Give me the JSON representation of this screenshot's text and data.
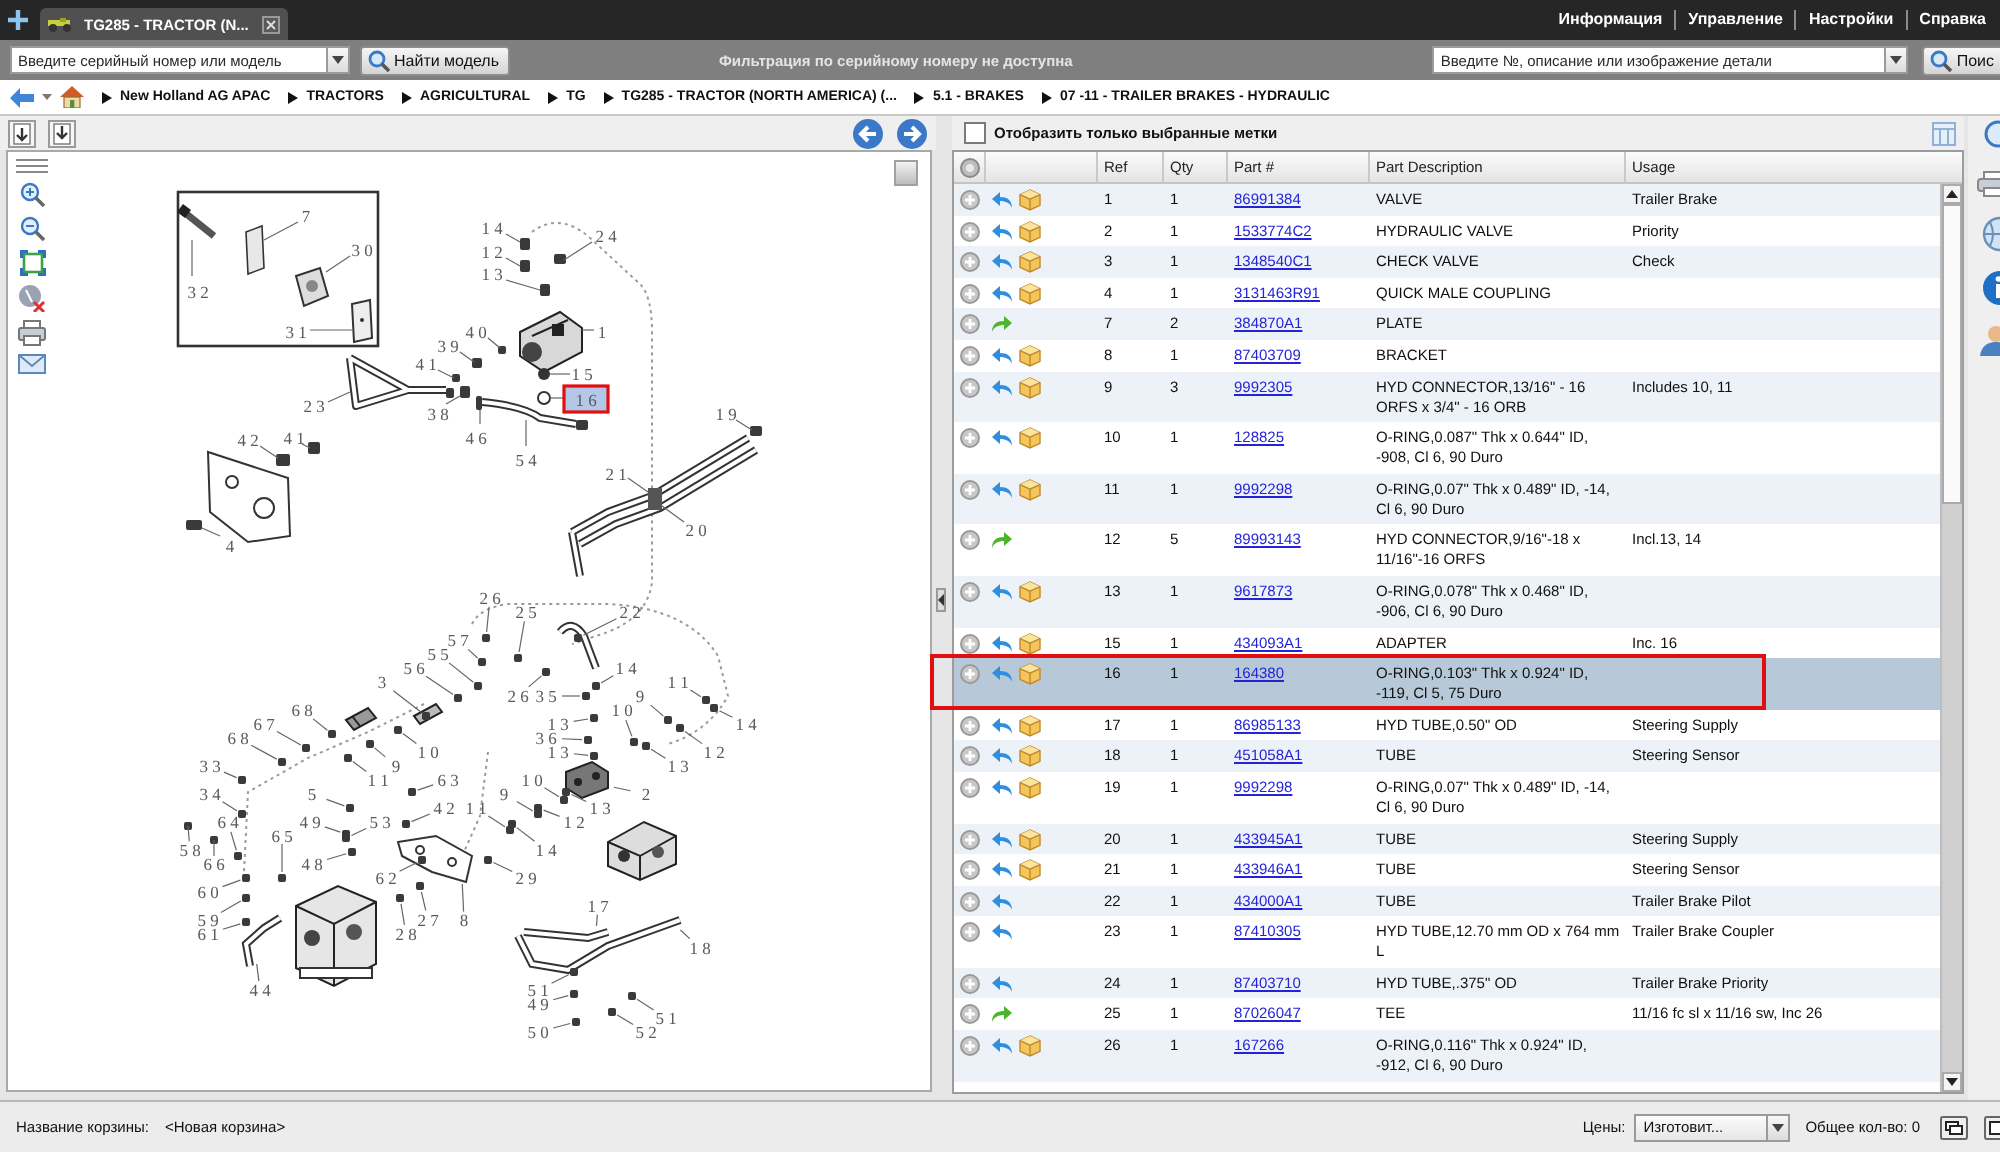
{
  "top_bar": {
    "tabs": [
      {
        "label": "TG285 - TRACTOR (N...",
        "selected": true
      }
    ],
    "links": [
      "Информация",
      "Управление",
      "Настройки",
      "Справка"
    ]
  },
  "search_bar": {
    "model_field": {
      "placeholder": "Введите серийный номер или модель"
    },
    "model_button": "Найти модель",
    "filter_notice": "Фильтрация по серийному номеру не доступна",
    "part_field": {
      "placeholder": "Введите №, описание или изображение детали"
    },
    "part_button": "Поис"
  },
  "breadcrumb": [
    "New Holland AG APAC",
    "TRACTORS",
    "AGRICULTURAL",
    "TG",
    "TG285 - TRACTOR (NORTH AMERICA) (...",
    "5.1 - BRAKES",
    "07 -11 - TRAILER BRAKES - HYDRAULIC"
  ],
  "diagram": {
    "callouts": [
      {
        "label": "7",
        "selected": false
      },
      {
        "label": "1 4",
        "selected": false
      },
      {
        "label": "2 4",
        "selected": false
      },
      {
        "label": "3 0",
        "selected": false
      },
      {
        "label": "1 2",
        "selected": false
      },
      {
        "label": "1 3",
        "selected": false
      },
      {
        "label": "3 2",
        "selected": false
      },
      {
        "label": "3 1",
        "selected": false
      },
      {
        "label": "4 0",
        "selected": false
      },
      {
        "label": "1",
        "selected": false
      },
      {
        "label": "3 9",
        "selected": false
      },
      {
        "label": "4 1",
        "selected": false
      },
      {
        "label": "1 5",
        "selected": false
      },
      {
        "label": "2 3",
        "selected": false
      },
      {
        "label": "3 8",
        "selected": false
      },
      {
        "label": "1 6",
        "selected": true
      },
      {
        "label": "1 9",
        "selected": false
      },
      {
        "label": "4 2",
        "selected": false
      },
      {
        "label": "4 1",
        "selected": false
      },
      {
        "label": "4 6",
        "selected": false
      },
      {
        "label": "5 4",
        "selected": false
      },
      {
        "label": "2 1",
        "selected": false
      },
      {
        "label": "2 0",
        "selected": false
      },
      {
        "label": "4",
        "selected": false
      },
      {
        "label": "2 6",
        "selected": false
      },
      {
        "label": "2 5",
        "selected": false
      },
      {
        "label": "2 2",
        "selected": false
      },
      {
        "label": "5 7",
        "selected": false
      },
      {
        "label": "5 5",
        "selected": false
      },
      {
        "label": "5 6",
        "selected": false
      },
      {
        "label": "1 4",
        "selected": false
      },
      {
        "label": "3",
        "selected": false
      },
      {
        "label": "1 1",
        "selected": false
      },
      {
        "label": "2 6",
        "selected": false
      },
      {
        "label": "3 5",
        "selected": false
      },
      {
        "label": "9",
        "selected": false
      },
      {
        "label": "6 8",
        "selected": false
      },
      {
        "label": "1 0",
        "selected": false
      },
      {
        "label": "6 7",
        "selected": false
      },
      {
        "label": "1 3",
        "selected": false
      },
      {
        "label": "1 4",
        "selected": false
      },
      {
        "label": "6 8",
        "selected": false
      },
      {
        "label": "3 6",
        "selected": false
      },
      {
        "label": "1 0",
        "selected": false
      },
      {
        "label": "1 3",
        "selected": false
      },
      {
        "label": "1 2",
        "selected": false
      },
      {
        "label": "3 3",
        "selected": false
      },
      {
        "label": "9",
        "selected": false
      },
      {
        "label": "1 3",
        "selected": false
      },
      {
        "label": "1 1",
        "selected": false
      },
      {
        "label": "6 3",
        "selected": false
      },
      {
        "label": "1 0",
        "selected": false
      },
      {
        "label": "3 4",
        "selected": false
      },
      {
        "label": "5",
        "selected": false
      },
      {
        "label": "9",
        "selected": false
      },
      {
        "label": "2",
        "selected": false
      },
      {
        "label": "4 2",
        "selected": false
      },
      {
        "label": "1 1",
        "selected": false
      },
      {
        "label": "1 3",
        "selected": false
      },
      {
        "label": "6 4",
        "selected": false
      },
      {
        "label": "4 9",
        "selected": false
      },
      {
        "label": "5 3",
        "selected": false
      },
      {
        "label": "1 2",
        "selected": false
      },
      {
        "label": "6 5",
        "selected": false
      },
      {
        "label": "5 8",
        "selected": false
      },
      {
        "label": "1 4",
        "selected": false
      },
      {
        "label": "6 6",
        "selected": false
      },
      {
        "label": "4 8",
        "selected": false
      },
      {
        "label": "6 2",
        "selected": false
      },
      {
        "label": "2 9",
        "selected": false
      },
      {
        "label": "6 0",
        "selected": false
      },
      {
        "label": "1 7",
        "selected": false
      },
      {
        "label": "5 9",
        "selected": false
      },
      {
        "label": "2 7",
        "selected": false
      },
      {
        "label": "8",
        "selected": false
      },
      {
        "label": "6 1",
        "selected": false
      },
      {
        "label": "2 8",
        "selected": false
      },
      {
        "label": "1 8",
        "selected": false
      },
      {
        "label": "4 4",
        "selected": false
      },
      {
        "label": "5 1",
        "selected": false
      },
      {
        "label": "4 9",
        "selected": false
      },
      {
        "label": "5 1",
        "selected": false
      },
      {
        "label": "5 0",
        "selected": false
      },
      {
        "label": "5 2",
        "selected": false
      }
    ]
  },
  "parts_panel": {
    "filter": {
      "label": "Отобразить только выбранные метки",
      "checked": false
    },
    "columns": [
      "Ref",
      "Qty",
      "Part #",
      "Part Description",
      "Usage"
    ],
    "rows": [
      {
        "kind": "part",
        "ref": "1",
        "qty": "1",
        "part": "86991384",
        "description": "VALVE",
        "usage": "Trailer Brake",
        "selected": false
      },
      {
        "kind": "part",
        "ref": "2",
        "qty": "1",
        "part": "1533774C2",
        "description": "HYDRAULIC VALVE",
        "usage": "Priority",
        "selected": false
      },
      {
        "kind": "part",
        "ref": "3",
        "qty": "1",
        "part": "1348540C1",
        "description": "CHECK VALVE",
        "usage": "Check",
        "selected": false
      },
      {
        "kind": "part",
        "ref": "4",
        "qty": "1",
        "part": "3131463R91",
        "description": "QUICK MALE COUPLING",
        "selected": false
      },
      {
        "kind": "kit",
        "ref": "7",
        "qty": "2",
        "part": "384870A1",
        "description": "PLATE",
        "selected": false
      },
      {
        "kind": "part",
        "ref": "8",
        "qty": "1",
        "part": "87403709",
        "description": "BRACKET",
        "selected": false
      },
      {
        "kind": "part",
        "ref": "9",
        "qty": "3",
        "part": "9992305",
        "description": "HYD CONNECTOR,13/16\" - 16 ORFS x 3/4\" - 16 ORB",
        "usage": "Includes 10, 11",
        "selected": false
      },
      {
        "kind": "part",
        "ref": "10",
        "qty": "1",
        "part": "128825",
        "description": "O-RING,0.087\" Thk x 0.644\" ID, -908, Cl 6, 90 Duro",
        "selected": false
      },
      {
        "kind": "part",
        "ref": "11",
        "qty": "1",
        "part": "9992298",
        "description": "O-RING,0.07\" Thk x 0.489\" ID, -14, Cl 6, 90 Duro",
        "selected": false
      },
      {
        "kind": "kit",
        "ref": "12",
        "qty": "5",
        "part": "89993143",
        "description": "HYD CONNECTOR,9/16\"-18 x 11/16\"-16 ORFS",
        "usage": "Incl.13, 14",
        "selected": false
      },
      {
        "kind": "part",
        "ref": "13",
        "qty": "1",
        "part": "9617873",
        "description": "O-RING,0.078\" Thk x 0.468\" ID, -906, Cl 6, 90 Duro",
        "selected": false
      },
      {
        "kind": "part",
        "ref": "15",
        "qty": "1",
        "part": "434093A1",
        "description": "ADAPTER",
        "usage": "Inc. 16",
        "selected": false
      },
      {
        "kind": "part",
        "ref": "16",
        "qty": "1",
        "part": "164380",
        "description": "O-RING,0.103\" Thk x 0.924\" ID, -119, Cl 5, 75 Duro",
        "selected": true
      },
      {
        "kind": "part",
        "ref": "17",
        "qty": "1",
        "part": "86985133",
        "description": "HYD TUBE,0.50\" OD",
        "usage": "Steering Supply",
        "selected": false
      },
      {
        "kind": "part",
        "ref": "18",
        "qty": "1",
        "part": "451058A1",
        "description": "TUBE",
        "usage": "Steering Sensor",
        "selected": false
      },
      {
        "kind": "part",
        "ref": "19",
        "qty": "1",
        "part": "9992298",
        "description": "O-RING,0.07\" Thk x 0.489\" ID, -14, Cl 6, 90 Duro",
        "selected": false
      },
      {
        "kind": "part",
        "ref": "20",
        "qty": "1",
        "part": "433945A1",
        "description": "TUBE",
        "usage": "Steering Supply",
        "selected": false
      },
      {
        "kind": "part",
        "ref": "21",
        "qty": "1",
        "part": "433946A1",
        "description": "TUBE",
        "usage": "Steering Sensor",
        "selected": false
      },
      {
        "kind": "link",
        "ref": "22",
        "qty": "1",
        "part": "434000A1",
        "description": "TUBE",
        "usage": "Trailer Brake Pilot",
        "selected": false
      },
      {
        "kind": "link",
        "ref": "23",
        "qty": "1",
        "part": "87410305",
        "description": "HYD TUBE,12.70 mm OD x 764 mm L",
        "usage": "Trailer Brake Coupler",
        "selected": false
      },
      {
        "kind": "link",
        "ref": "24",
        "qty": "1",
        "part": "87403710",
        "description": "HYD TUBE,.375\" OD",
        "usage": "Trailer Brake Priority",
        "selected": false
      },
      {
        "kind": "kit",
        "ref": "25",
        "qty": "1",
        "part": "87026047",
        "description": "TEE",
        "usage": "11/16 fc sl x 11/16 sw, Inc 26",
        "selected": false
      },
      {
        "kind": "part",
        "ref": "26",
        "qty": "1",
        "part": "167266",
        "description": "O-RING,0.116\" Thk x 0.924\" ID, -912, Cl 6, 90 Duro",
        "selected": false
      }
    ]
  },
  "status_bar": {
    "basket_label": "Название корзины:",
    "basket_name": "<Новая корзина>",
    "prices_label": "Цены:",
    "prices_select": "Изготовит...",
    "total": "Общее кол-во: 0"
  }
}
